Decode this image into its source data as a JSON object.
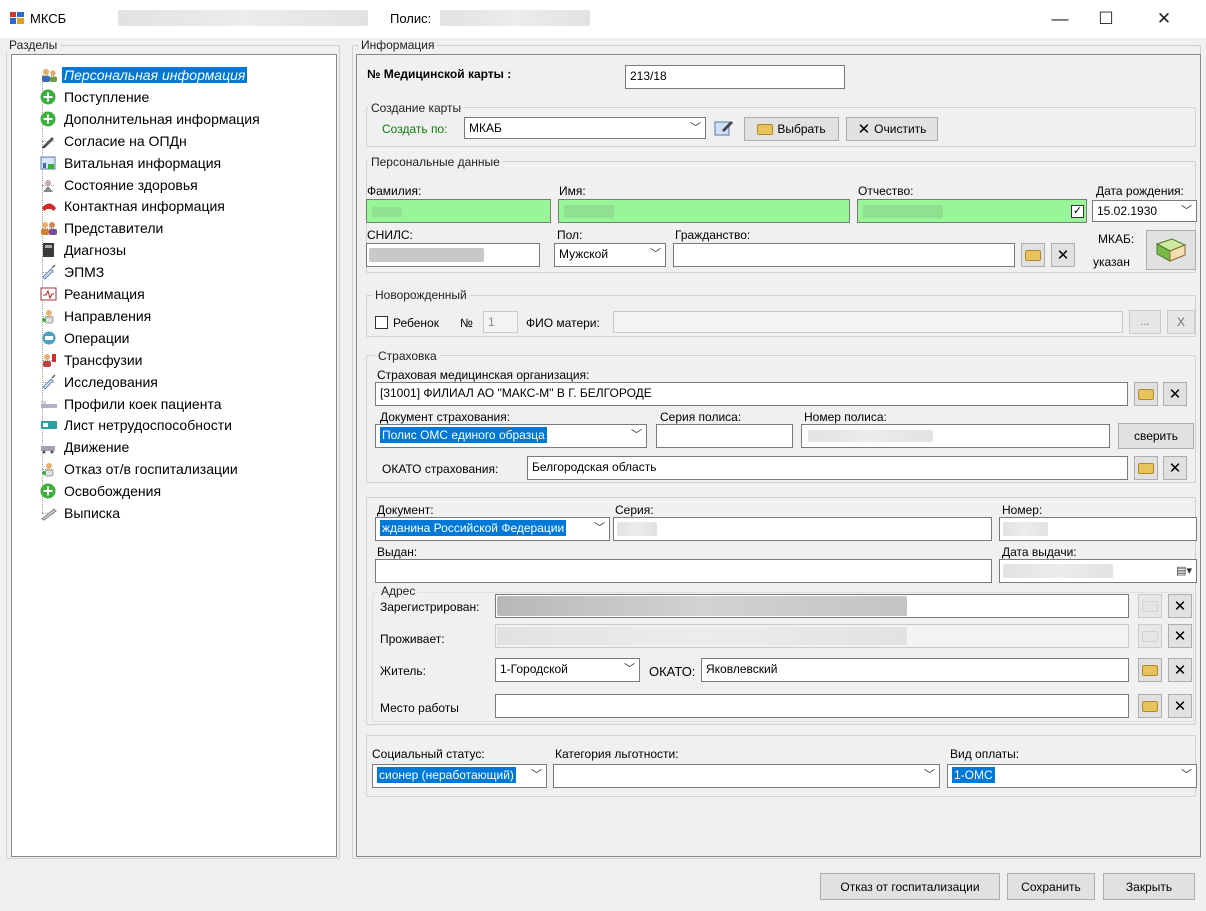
{
  "window": {
    "app_title": "МКСБ",
    "policy_label": "Полис:",
    "min": "—",
    "max": "☐",
    "close": "✕"
  },
  "sections": {
    "title": "Разделы",
    "items": [
      {
        "label": "Персональная информация",
        "icon": "person-icon",
        "selected": true
      },
      {
        "label": "Поступление",
        "icon": "plus-circle-icon"
      },
      {
        "label": "Дополнительная информация",
        "icon": "plus-circle-icon"
      },
      {
        "label": "Согласие на ОПДн",
        "icon": "pen-icon"
      },
      {
        "label": "Витальная информация",
        "icon": "vitals-icon"
      },
      {
        "label": "Состояние здоровья",
        "icon": "health-icon"
      },
      {
        "label": "Контактная информация",
        "icon": "phone-icon"
      },
      {
        "label": "Представители",
        "icon": "people-icon"
      },
      {
        "label": "Диагнозы",
        "icon": "book-icon"
      },
      {
        "label": "ЭПМЗ",
        "icon": "syringe-icon"
      },
      {
        "label": "Реанимация",
        "icon": "monitor-icon"
      },
      {
        "label": "Направления",
        "icon": "doctor-icon"
      },
      {
        "label": "Операции",
        "icon": "surgery-icon"
      },
      {
        "label": "Трансфузии",
        "icon": "transfusion-icon"
      },
      {
        "label": "Исследования",
        "icon": "syringe-icon"
      },
      {
        "label": "Профили коек пациента",
        "icon": "bed-icon"
      },
      {
        "label": "Лист нетрудоспособности",
        "icon": "sick-leave-icon"
      },
      {
        "label": "Движение",
        "icon": "movement-icon"
      },
      {
        "label": "Отказ от/в госпитализации",
        "icon": "doctor-icon"
      },
      {
        "label": "Освобождения",
        "icon": "plus-circle-icon"
      },
      {
        "label": "Выписка",
        "icon": "discharge-icon"
      }
    ]
  },
  "info": {
    "title": "Информация",
    "card_no_label": "№ Медицинской карты :",
    "card_no_value": "213/18",
    "create": {
      "group": "Создание карты",
      "create_by_label": "Создать по:",
      "create_by_value": "МКАБ",
      "select_btn": "Выбрать",
      "clear_btn": "Очистить"
    },
    "personal": {
      "group": "Персональные данные",
      "surname_label": "Фамилия:",
      "name_label": "Имя:",
      "patronymic_label": "Отчество:",
      "dob_label": "Дата рождения:",
      "dob_value": "15.02.1930",
      "snils_label": "СНИЛС:",
      "sex_label": "Пол:",
      "sex_value": "Мужской",
      "citizenship_label": "Гражданство:",
      "mkab_label": "МКАБ:",
      "mkab_value": "указан"
    },
    "newborn": {
      "group": "Новорожденный",
      "child_label": "Ребенок",
      "no_label": "№",
      "no_value": "1",
      "mother_label": "ФИО матери:",
      "dots": "...",
      "x": "X"
    },
    "insurance": {
      "group": "Страховка",
      "org_label": "Страховая медицинская организация:",
      "org_value": "[31001] ФИЛИАЛ АО \"МАКС-М\" В Г. БЕЛГОРОДЕ",
      "doc_label": "Документ страхования:",
      "doc_value": "Полис ОМС единого образца",
      "series_label": "Серия полиса:",
      "number_label": "Номер полиса:",
      "verify_btn": "сверить",
      "okato_label": "ОКАТО страхования:",
      "okato_value": "Белгородская область"
    },
    "document": {
      "doc_label": "Документ:",
      "doc_value": "жданина Российской Федерации",
      "series_label": "Серия:",
      "number_label": "Номер:",
      "issued_label": "Выдан:",
      "issue_date_label": "Дата выдачи:"
    },
    "address": {
      "group": "Адрес",
      "registered_label": "Зарегистрирован:",
      "lives_label": "Проживает:",
      "resident_label": "Житель:",
      "resident_value": "1-Городской",
      "okato_label": "ОКАТО:",
      "okato_value": "Яковлевский",
      "work_label": "Место работы"
    },
    "social": {
      "status_label": "Социальный статус:",
      "status_value": "сионер (неработающий)",
      "benefit_label": "Категория льготности:",
      "payment_label": "Вид оплаты:",
      "payment_value": "1-ОМС"
    }
  },
  "footer": {
    "refuse_btn": "Отказ от госпитализации",
    "save_btn": "Сохранить",
    "close_btn": "Закрыть"
  },
  "colors": {
    "required_field": "#98f598",
    "selection": "#0078d7",
    "create_by_label": "#0a7a0a"
  }
}
